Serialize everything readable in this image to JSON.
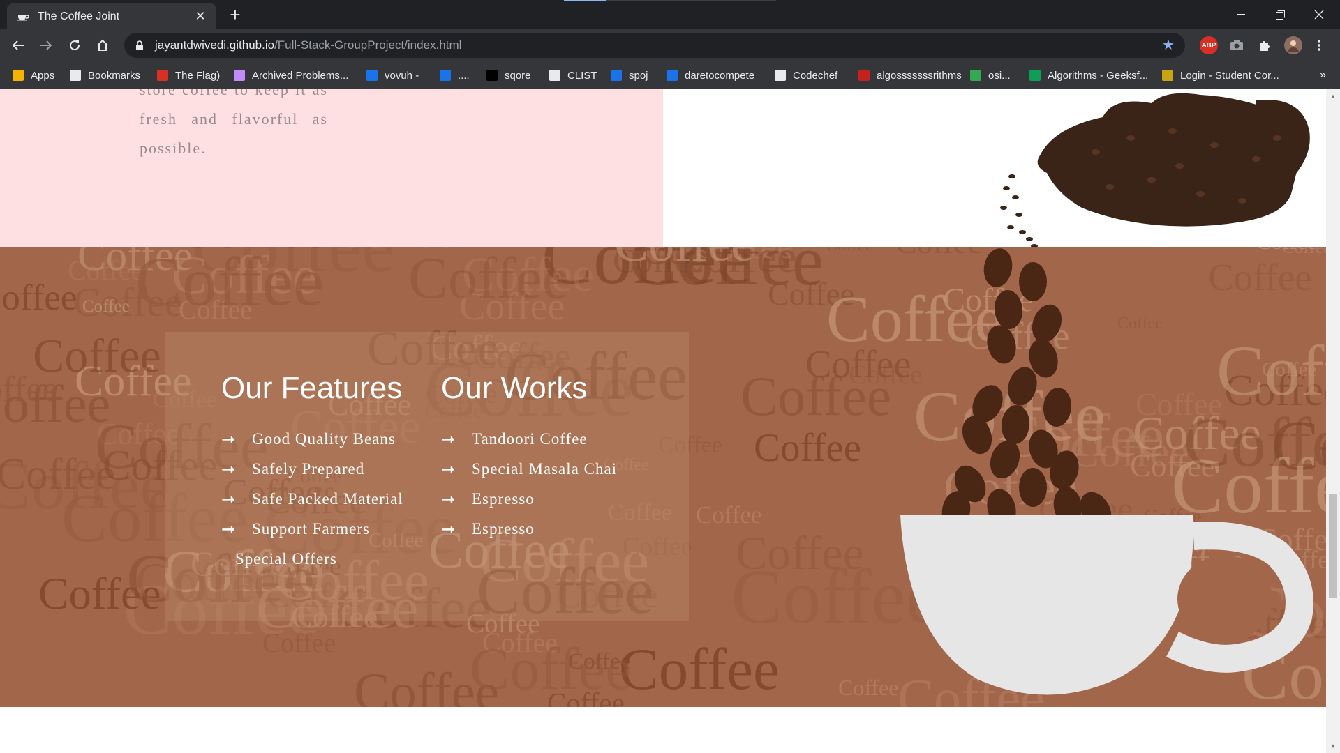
{
  "browser": {
    "tab_title": "The Coffee Joint",
    "url_host": "jayantdwivedi.github.io",
    "url_path": "/Full-Stack-GroupProject/index.html",
    "close_glyph": "✕",
    "new_tab_glyph": "+",
    "ext_abp_label": "ABP",
    "more_glyph": "»"
  },
  "bookmarks": [
    {
      "label": "Apps",
      "icon": "apps-grid-icon",
      "color": "#f4b400"
    },
    {
      "label": "Bookmarks",
      "icon": "star-icon",
      "color": "#e8eaed"
    },
    {
      "label": "The Flag)",
      "icon": "flag-icon",
      "color": "#d93025"
    },
    {
      "label": "Archived Problems...",
      "icon": "archive-icon",
      "color": "#c58af9"
    },
    {
      "label": "vovuh -",
      "icon": "bars-icon",
      "color": "#1a73e8"
    },
    {
      "label": "....",
      "icon": "bars-icon",
      "color": "#1a73e8"
    },
    {
      "label": "sqore",
      "icon": "square-icon",
      "color": "#000000"
    },
    {
      "label": "CLIST",
      "icon": "globe-icon",
      "color": "#e8eaed"
    },
    {
      "label": "spoj",
      "icon": "s-icon",
      "color": "#1a73e8"
    },
    {
      "label": "daretocompete",
      "icon": "puzzle-icon",
      "color": "#1a73e8"
    },
    {
      "label": "Codechef",
      "icon": "cc-icon",
      "color": "#e8eaed"
    },
    {
      "label": "algosssssssrithms",
      "icon": "q-icon",
      "color": "#c5221f"
    },
    {
      "label": "osi...",
      "icon": "headphones-icon",
      "color": "#34a853"
    },
    {
      "label": "Algorithms - Geeksf...",
      "icon": "gfg-icon",
      "color": "#0f9d58"
    },
    {
      "label": "Login - Student Cor...",
      "icon": "crown-icon",
      "color": "#c8a415"
    }
  ],
  "page": {
    "intro_text": "store coffee to keep it as fresh and flavorful as possible.",
    "features": {
      "title": "Our Features",
      "items": [
        "Good Quality Beans",
        "Safely Prepared",
        "Safe Packed Material",
        "Support Farmers"
      ],
      "extra": "Special Offers"
    },
    "works": {
      "title": "Our Works",
      "items": [
        "Tandoori Coffee",
        "Special Masala Chai",
        "Espresso",
        "Espresso"
      ]
    },
    "arrow_glyph": "➞",
    "background_word": "Coffee"
  },
  "colors": {
    "chrome_dark": "#202124",
    "chrome_toolbar": "#35363a",
    "pink_section": "#ffe0e2",
    "coffee_band": "#a2674a",
    "accent_blue": "#8ab4f8"
  }
}
